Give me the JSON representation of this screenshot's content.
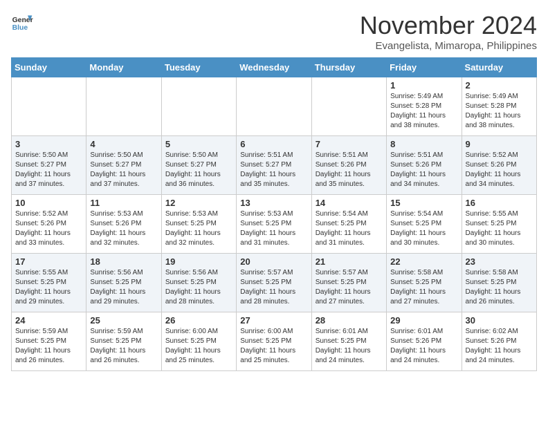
{
  "header": {
    "logo_line1": "General",
    "logo_line2": "Blue",
    "month_year": "November 2024",
    "location": "Evangelista, Mimaropa, Philippines"
  },
  "weekdays": [
    "Sunday",
    "Monday",
    "Tuesday",
    "Wednesday",
    "Thursday",
    "Friday",
    "Saturday"
  ],
  "weeks": [
    [
      {
        "day": "",
        "info": ""
      },
      {
        "day": "",
        "info": ""
      },
      {
        "day": "",
        "info": ""
      },
      {
        "day": "",
        "info": ""
      },
      {
        "day": "",
        "info": ""
      },
      {
        "day": "1",
        "info": "Sunrise: 5:49 AM\nSunset: 5:28 PM\nDaylight: 11 hours\nand 38 minutes."
      },
      {
        "day": "2",
        "info": "Sunrise: 5:49 AM\nSunset: 5:28 PM\nDaylight: 11 hours\nand 38 minutes."
      }
    ],
    [
      {
        "day": "3",
        "info": "Sunrise: 5:50 AM\nSunset: 5:27 PM\nDaylight: 11 hours\nand 37 minutes."
      },
      {
        "day": "4",
        "info": "Sunrise: 5:50 AM\nSunset: 5:27 PM\nDaylight: 11 hours\nand 37 minutes."
      },
      {
        "day": "5",
        "info": "Sunrise: 5:50 AM\nSunset: 5:27 PM\nDaylight: 11 hours\nand 36 minutes."
      },
      {
        "day": "6",
        "info": "Sunrise: 5:51 AM\nSunset: 5:27 PM\nDaylight: 11 hours\nand 35 minutes."
      },
      {
        "day": "7",
        "info": "Sunrise: 5:51 AM\nSunset: 5:26 PM\nDaylight: 11 hours\nand 35 minutes."
      },
      {
        "day": "8",
        "info": "Sunrise: 5:51 AM\nSunset: 5:26 PM\nDaylight: 11 hours\nand 34 minutes."
      },
      {
        "day": "9",
        "info": "Sunrise: 5:52 AM\nSunset: 5:26 PM\nDaylight: 11 hours\nand 34 minutes."
      }
    ],
    [
      {
        "day": "10",
        "info": "Sunrise: 5:52 AM\nSunset: 5:26 PM\nDaylight: 11 hours\nand 33 minutes."
      },
      {
        "day": "11",
        "info": "Sunrise: 5:53 AM\nSunset: 5:26 PM\nDaylight: 11 hours\nand 32 minutes."
      },
      {
        "day": "12",
        "info": "Sunrise: 5:53 AM\nSunset: 5:25 PM\nDaylight: 11 hours\nand 32 minutes."
      },
      {
        "day": "13",
        "info": "Sunrise: 5:53 AM\nSunset: 5:25 PM\nDaylight: 11 hours\nand 31 minutes."
      },
      {
        "day": "14",
        "info": "Sunrise: 5:54 AM\nSunset: 5:25 PM\nDaylight: 11 hours\nand 31 minutes."
      },
      {
        "day": "15",
        "info": "Sunrise: 5:54 AM\nSunset: 5:25 PM\nDaylight: 11 hours\nand 30 minutes."
      },
      {
        "day": "16",
        "info": "Sunrise: 5:55 AM\nSunset: 5:25 PM\nDaylight: 11 hours\nand 30 minutes."
      }
    ],
    [
      {
        "day": "17",
        "info": "Sunrise: 5:55 AM\nSunset: 5:25 PM\nDaylight: 11 hours\nand 29 minutes."
      },
      {
        "day": "18",
        "info": "Sunrise: 5:56 AM\nSunset: 5:25 PM\nDaylight: 11 hours\nand 29 minutes."
      },
      {
        "day": "19",
        "info": "Sunrise: 5:56 AM\nSunset: 5:25 PM\nDaylight: 11 hours\nand 28 minutes."
      },
      {
        "day": "20",
        "info": "Sunrise: 5:57 AM\nSunset: 5:25 PM\nDaylight: 11 hours\nand 28 minutes."
      },
      {
        "day": "21",
        "info": "Sunrise: 5:57 AM\nSunset: 5:25 PM\nDaylight: 11 hours\nand 27 minutes."
      },
      {
        "day": "22",
        "info": "Sunrise: 5:58 AM\nSunset: 5:25 PM\nDaylight: 11 hours\nand 27 minutes."
      },
      {
        "day": "23",
        "info": "Sunrise: 5:58 AM\nSunset: 5:25 PM\nDaylight: 11 hours\nand 26 minutes."
      }
    ],
    [
      {
        "day": "24",
        "info": "Sunrise: 5:59 AM\nSunset: 5:25 PM\nDaylight: 11 hours\nand 26 minutes."
      },
      {
        "day": "25",
        "info": "Sunrise: 5:59 AM\nSunset: 5:25 PM\nDaylight: 11 hours\nand 26 minutes."
      },
      {
        "day": "26",
        "info": "Sunrise: 6:00 AM\nSunset: 5:25 PM\nDaylight: 11 hours\nand 25 minutes."
      },
      {
        "day": "27",
        "info": "Sunrise: 6:00 AM\nSunset: 5:25 PM\nDaylight: 11 hours\nand 25 minutes."
      },
      {
        "day": "28",
        "info": "Sunrise: 6:01 AM\nSunset: 5:25 PM\nDaylight: 11 hours\nand 24 minutes."
      },
      {
        "day": "29",
        "info": "Sunrise: 6:01 AM\nSunset: 5:26 PM\nDaylight: 11 hours\nand 24 minutes."
      },
      {
        "day": "30",
        "info": "Sunrise: 6:02 AM\nSunset: 5:26 PM\nDaylight: 11 hours\nand 24 minutes."
      }
    ]
  ]
}
